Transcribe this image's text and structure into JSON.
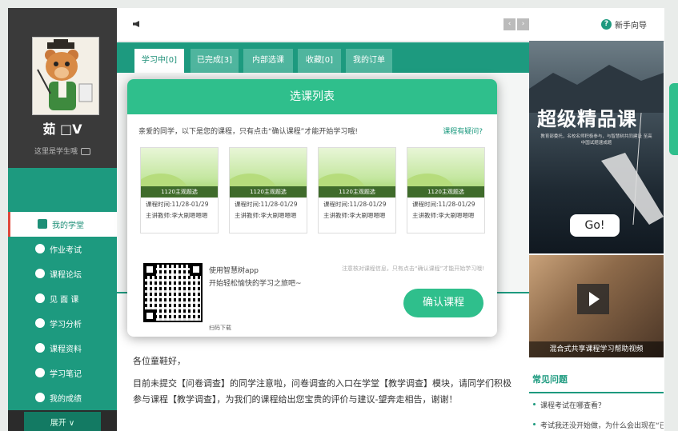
{
  "sidebar": {
    "username": "茹 □V",
    "user_note": "这里是学生哦",
    "nav": [
      {
        "label": "我的学堂",
        "active": true
      },
      {
        "label": "作业考试"
      },
      {
        "label": "课程论坛"
      },
      {
        "label": "见 面 课"
      },
      {
        "label": "学习分析"
      },
      {
        "label": "课程资料"
      },
      {
        "label": "学习笔记"
      },
      {
        "label": "我的成绩"
      }
    ],
    "expand_label": "展开 ∨"
  },
  "topbar": {
    "guide_label": "新手向导",
    "prev_label": "‹",
    "next_label": "›"
  },
  "tabs": [
    {
      "label": "学习中[0]"
    },
    {
      "label": "已完成[3]"
    },
    {
      "label": "内部选课"
    },
    {
      "label": "收藏[0]"
    },
    {
      "label": "我的订单"
    }
  ],
  "modal": {
    "title": "选课列表",
    "description": "亲爱的同学，以下是您的课程，只有点击“确认课程”才能开始学习哦!",
    "question_link": "课程有疑问?",
    "courses": [
      {
        "tag": "1120主观题选",
        "period": "课程时间:11/28-01/29",
        "teacher": "主讲教师:李大刷嗯嗯嗯"
      },
      {
        "tag": "1120主观题选",
        "period": "课程时间:11/28-01/29",
        "teacher": "主讲教师:李大刷嗯嗯嗯"
      },
      {
        "tag": "1120主观题选",
        "period": "课程时间:11/28-01/29",
        "teacher": "主讲教师:李大刷嗯嗯嗯"
      },
      {
        "tag": "1120主观题选",
        "period": "课程时间:11/28-01/29",
        "teacher": "主讲教师:李大刷嗯嗯嗯"
      }
    ],
    "app_title": "使用智慧树app",
    "app_subtitle": "开始轻松愉快的学习之旅吧~",
    "scan_label": "扫码下载",
    "tip": "注意核对课程信息，只有点击“确认课程”才能开始学习哦!",
    "confirm_label": "确认课程"
  },
  "notice": {
    "greeting": "各位童鞋好，",
    "body": "目前未提交【问卷调查】的同学注意啦，问卷调查的入口在学堂【教学调查】模块，请同学们积极参与课程【教学调查】，为我们的课程给出您宝贵的评价与建议-望奔走相告，谢谢！"
  },
  "ad": {
    "title": "超级精品课",
    "subtitle": "教育部委托，名校名师积极参与，与智慧树共同建设 至高中国试题速成题",
    "go_label": "Go!"
  },
  "video": {
    "caption": "混合式共享课程学习帮助视频"
  },
  "faq": {
    "title": "常见问题",
    "items": [
      "课程考试在哪查看？",
      "考试我还没开始做，为什么会出现在“已…"
    ]
  }
}
